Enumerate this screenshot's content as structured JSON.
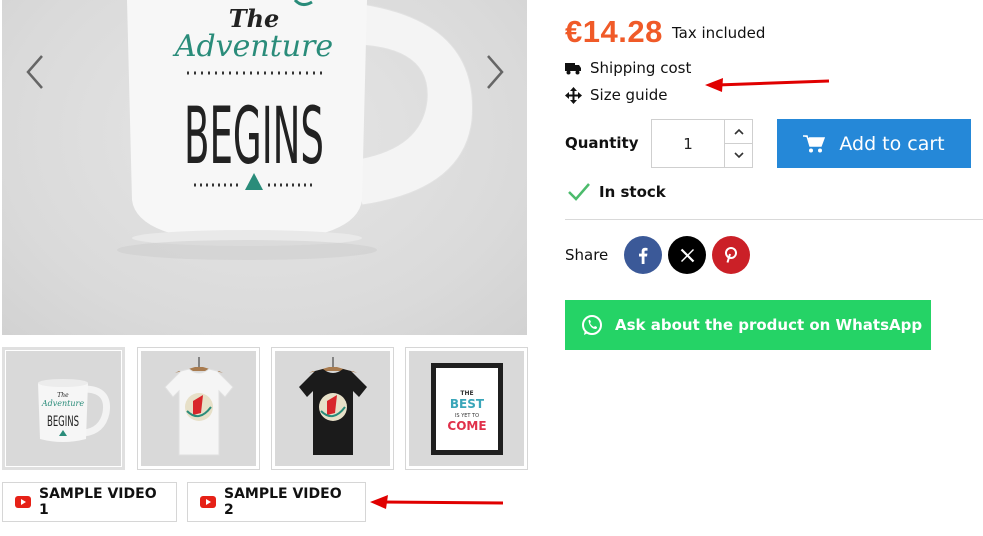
{
  "gallery": {
    "mug_text": {
      "line1": "The",
      "line2": "Adventure",
      "line3": "BEGINS"
    },
    "prev_icon": "chevron-left-icon",
    "next_icon": "chevron-right-icon",
    "thumbnails": [
      {
        "name": "thumbnail-mug",
        "mini_text": {
          "line1": "The",
          "line2": "Adventure",
          "line3": "BEGINS"
        }
      },
      {
        "name": "thumbnail-white-tshirt"
      },
      {
        "name": "thumbnail-black-tshirt"
      },
      {
        "name": "thumbnail-framed-poster",
        "poster_text": {
          "line1": "THE",
          "line2": "BEST",
          "line3": "IS YET TO",
          "line4": "COME"
        }
      }
    ],
    "videos": [
      {
        "label": "SAMPLE VIDEO 1",
        "icon": "youtube-icon"
      },
      {
        "label": "SAMPLE VIDEO 2",
        "icon": "youtube-icon"
      }
    ]
  },
  "product": {
    "price": "€14.28",
    "tax_label": "Tax included",
    "shipping_label": "Shipping cost",
    "size_guide_label": "Size guide",
    "quantity_label": "Quantity",
    "quantity_value": "1",
    "add_to_cart_label": "Add to cart",
    "stock_label": "In stock",
    "share_label": "Share",
    "whatsapp_label": "Ask about the product on WhatsApp"
  },
  "colors": {
    "price": "#f05a28",
    "add_to_cart": "#2588d8",
    "whatsapp": "#25d366",
    "facebook": "#3b5998",
    "x": "#000000",
    "pinterest": "#cb2027",
    "in_stock_check": "#4cbb6c",
    "annotation_arrow": "#e00000"
  }
}
